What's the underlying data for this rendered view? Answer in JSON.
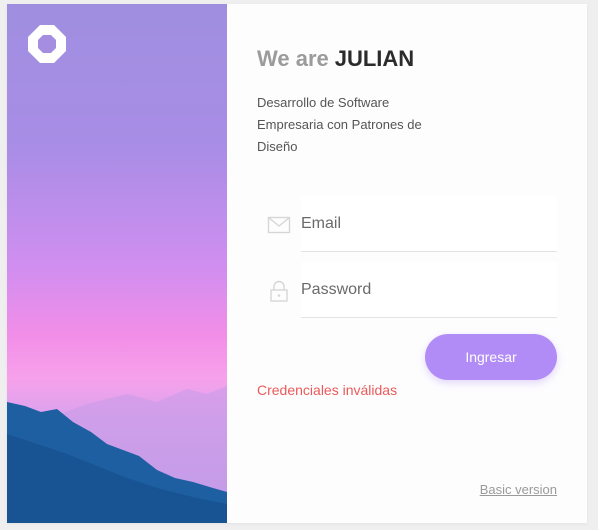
{
  "brand": {
    "heading_prefix": "We are",
    "heading_name": "JULIAN",
    "subtitle": "Desarrollo de Software Empresaria con Patrones de Diseño"
  },
  "form": {
    "email_placeholder": "Email",
    "password_placeholder": "Password",
    "submit_label": "Ingresar",
    "error_message": "Credenciales inválidas",
    "basic_version_link": "Basic version"
  },
  "icons": {
    "logo": "hexagon-ring-logo",
    "email": "envelope-icon",
    "password": "lock-icon"
  },
  "colors": {
    "accent": "#b28cf6",
    "error": "#ea5a5a",
    "heading_prefix": "#9b9b9b",
    "heading_name": "#2b2b2b"
  }
}
